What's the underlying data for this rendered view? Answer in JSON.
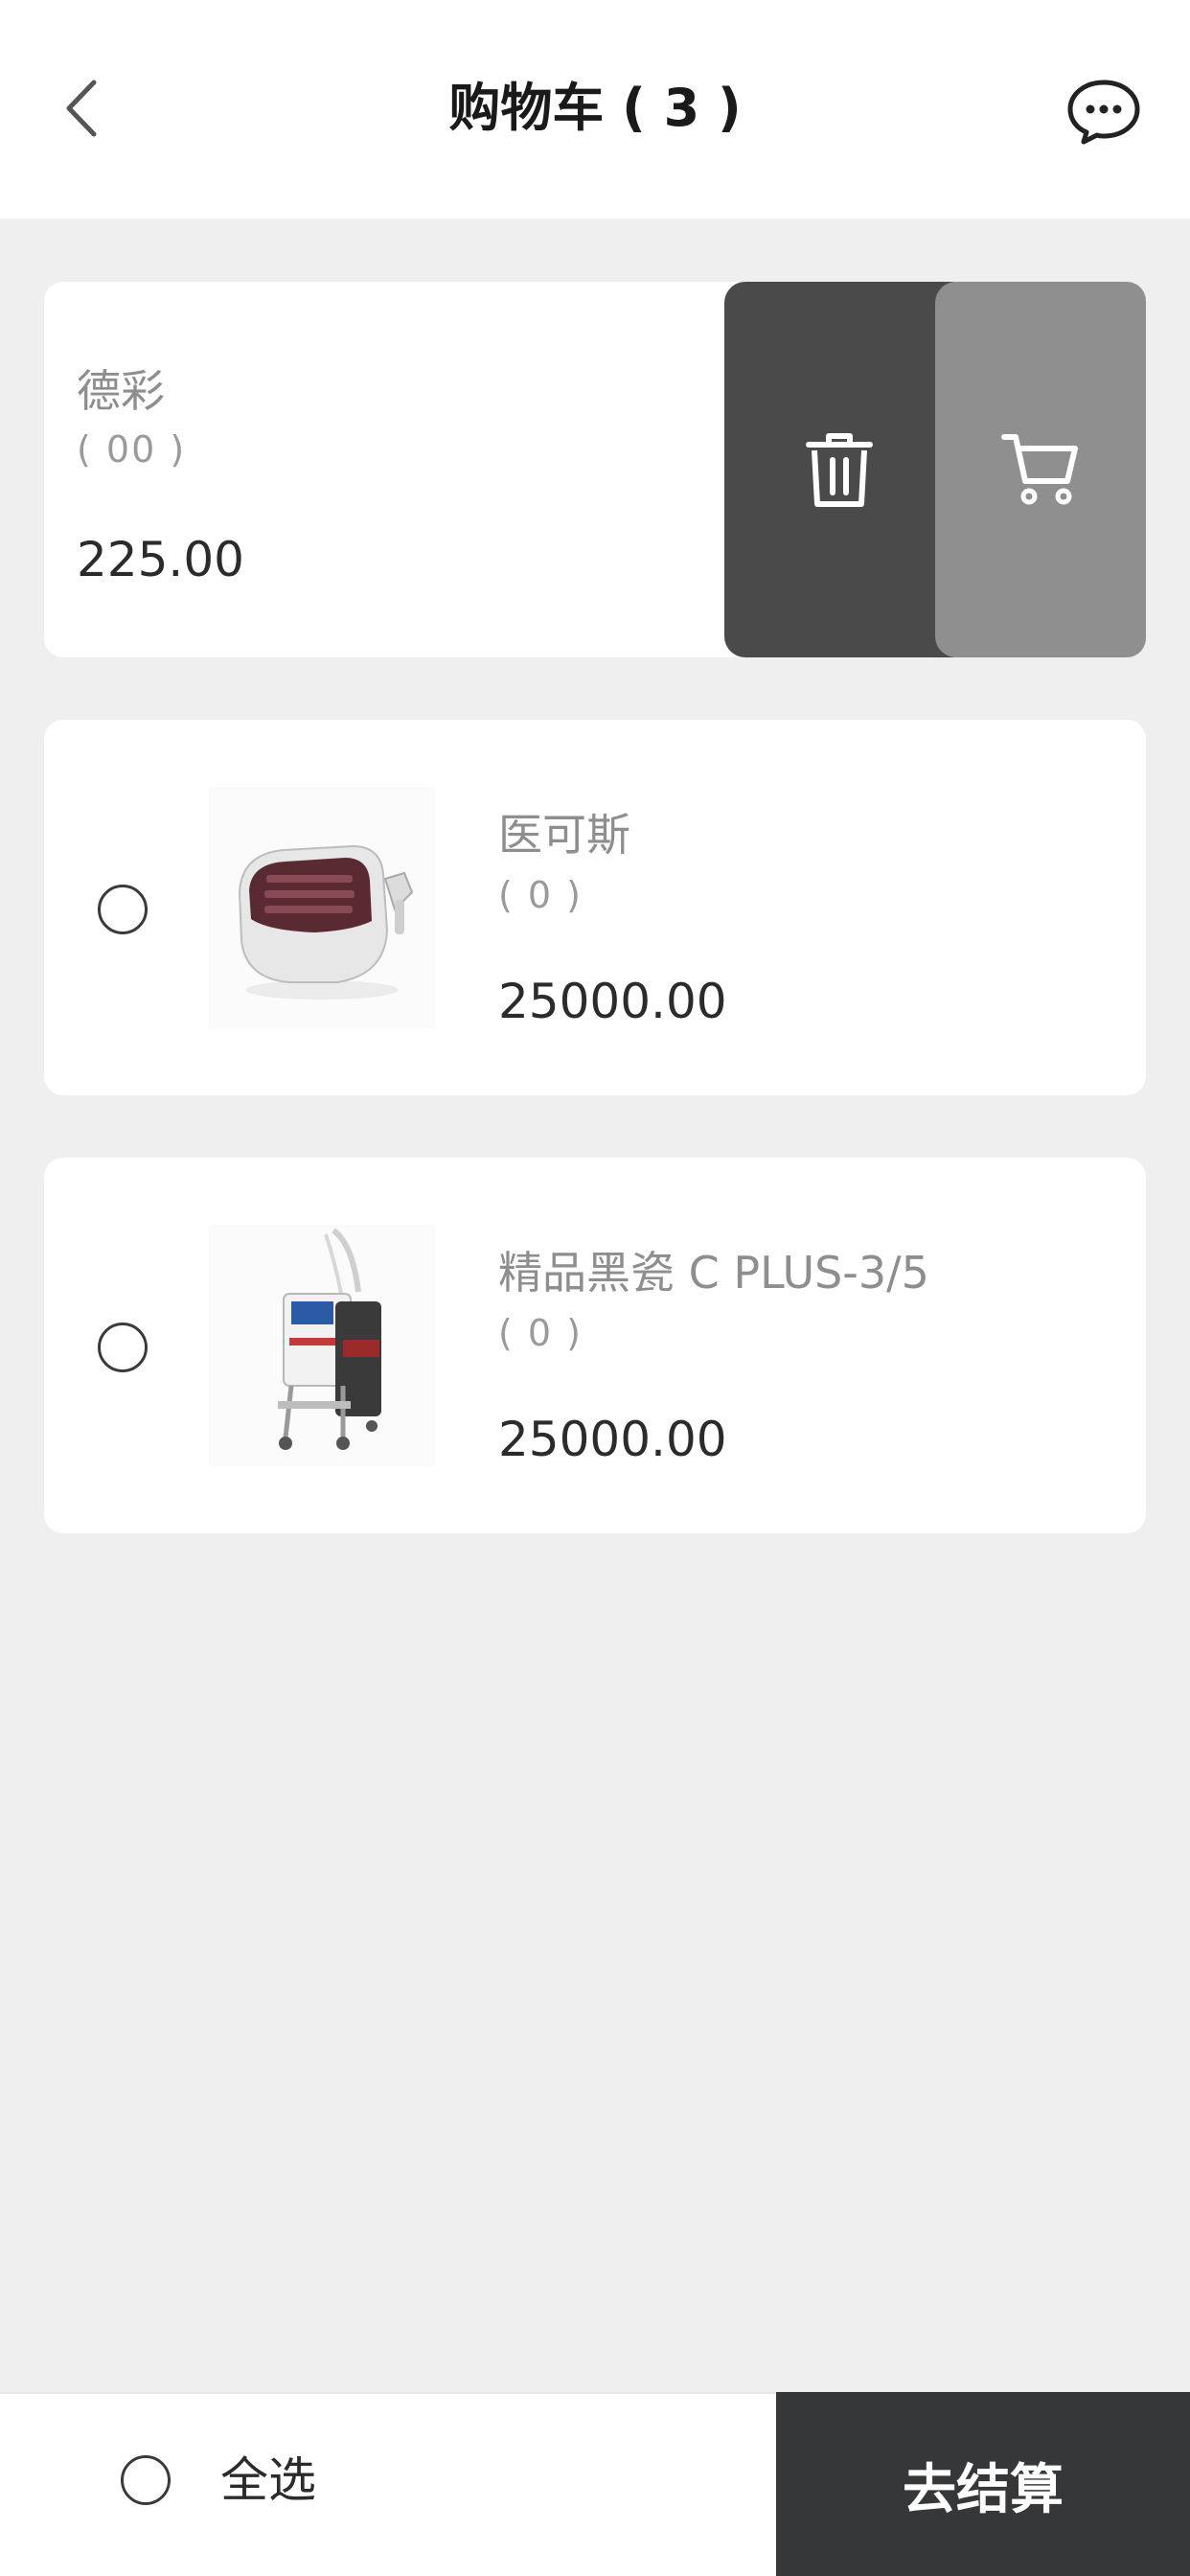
{
  "header": {
    "title": "购物车 ( 3 )",
    "back_icon": "chevron-left-icon",
    "message_icon": "chat-bubble-icon"
  },
  "cart_items": [
    {
      "name": "德彩",
      "quantity": "( 00 )",
      "price": "225.00",
      "swiped": true
    },
    {
      "name": "医可斯",
      "quantity": "( 0 )",
      "price": "25000.00",
      "swiped": false
    },
    {
      "name": "精品黑瓷 C PLUS-3/5",
      "quantity": "( 0 )",
      "price": "25000.00",
      "swiped": false
    }
  ],
  "swipe_actions": {
    "delete_icon": "trash-icon",
    "cart_icon": "cart-icon",
    "delete_color": "#4a4a4b",
    "cart_color": "#8f8f8f"
  },
  "bottom_bar": {
    "select_all_label": "全选",
    "checkout_label": "去结算",
    "checkout_color": "#363738"
  }
}
